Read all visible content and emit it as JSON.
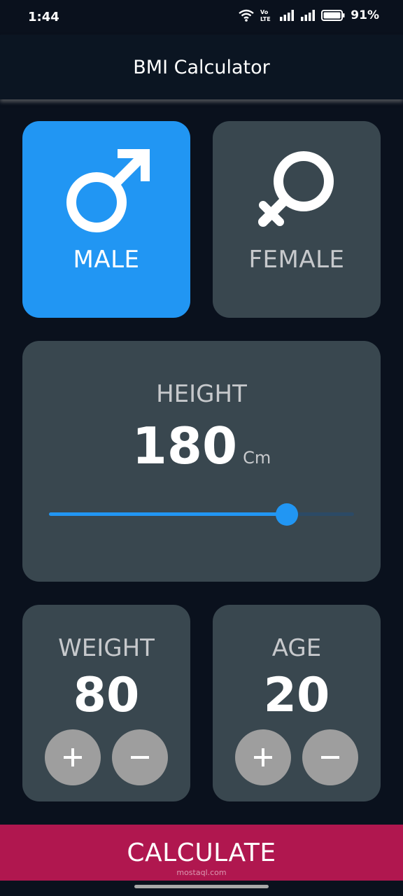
{
  "status_bar": {
    "time": "1:44",
    "battery_percent": "91%",
    "icons": [
      "wifi-icon",
      "volte-icon",
      "signal-icon",
      "signal-icon",
      "battery-icon"
    ]
  },
  "app_bar": {
    "title": "BMI Calculator"
  },
  "gender": {
    "male_label": "MALE",
    "female_label": "FEMALE",
    "selected": "male",
    "male_icon": "male-symbol-icon",
    "female_icon": "female-symbol-icon"
  },
  "height": {
    "label": "HEIGHT",
    "value": "180",
    "unit": "Cm",
    "slider_fraction": 0.779
  },
  "weight": {
    "label": "WEIGHT",
    "value": "80"
  },
  "age": {
    "label": "AGE",
    "value": "20"
  },
  "calculate": {
    "label": "CALCULATE"
  },
  "watermark": {
    "text": "mostaql.com"
  },
  "colors": {
    "background": "#0a111d",
    "card": "#39474f",
    "accent": "#2196f3",
    "calculate": "#b0174f",
    "round_button": "#9e9e9e"
  }
}
